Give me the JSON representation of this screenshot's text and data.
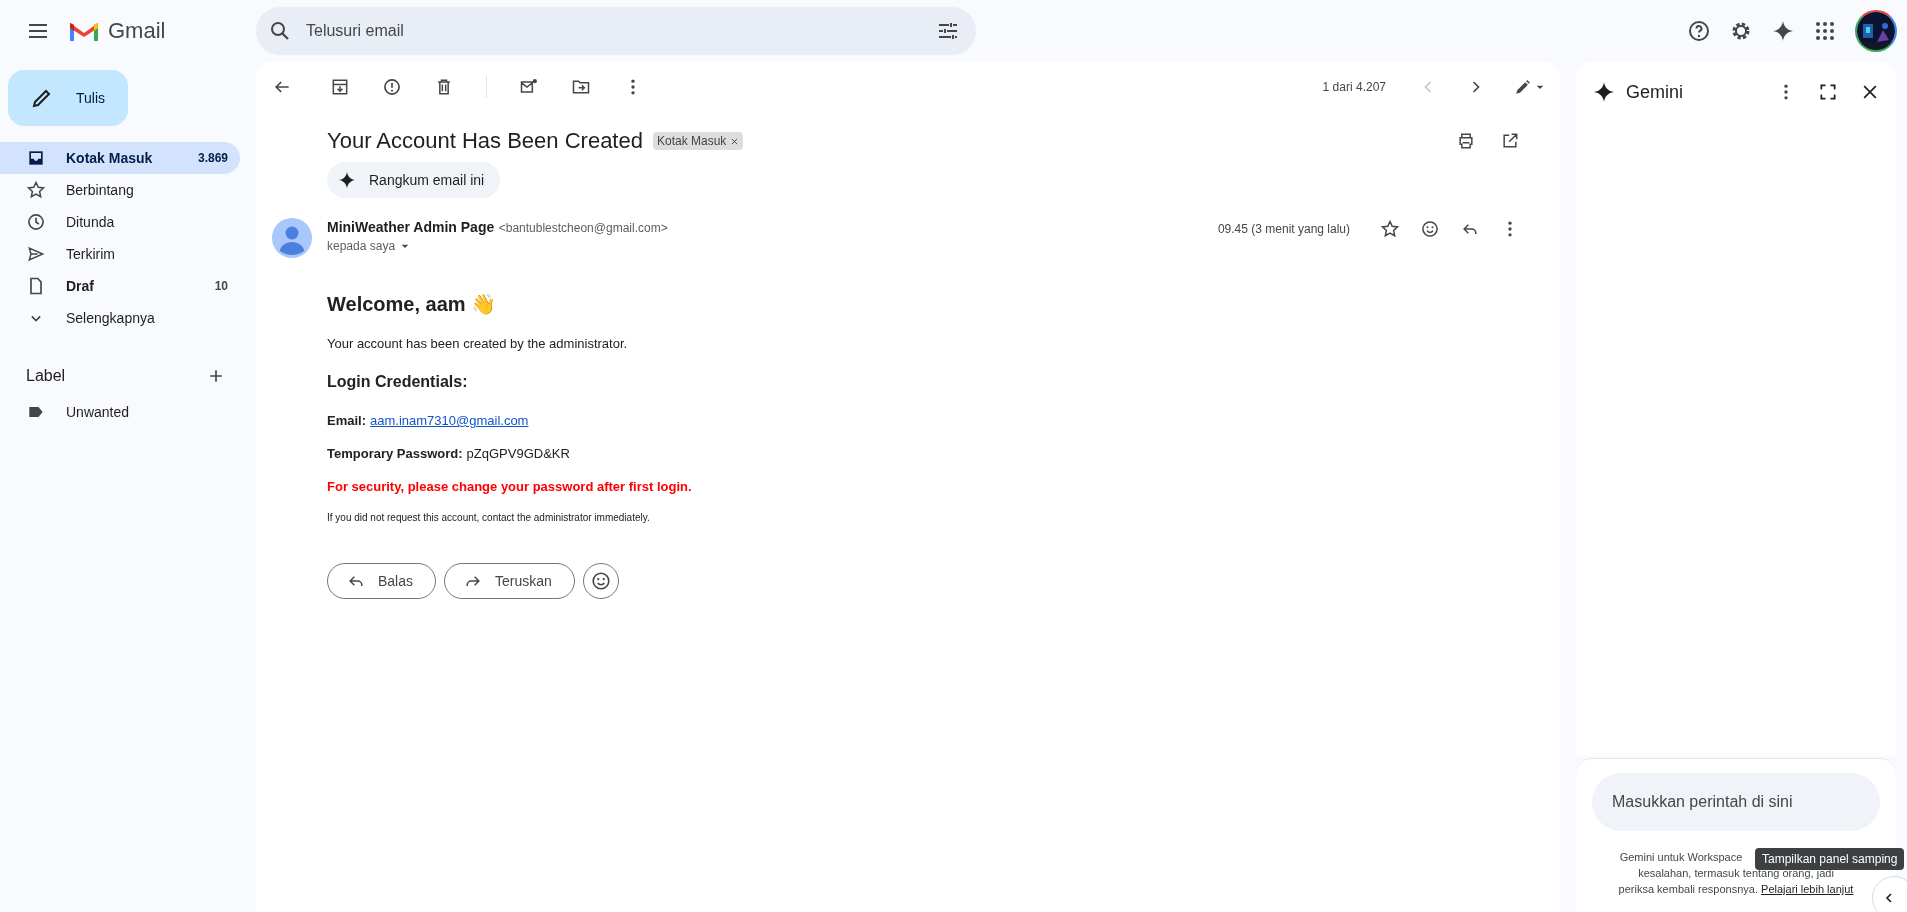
{
  "header": {
    "logo_text": "Gmail",
    "search": {
      "placeholder": "Telusuri email"
    }
  },
  "sidebar": {
    "compose": "Tulis",
    "items": [
      {
        "label": "Kotak Masuk",
        "count": "3.869",
        "selected": true,
        "unread": true
      },
      {
        "label": "Berbintang",
        "selected": false,
        "unread": false
      },
      {
        "label": "Ditunda",
        "selected": false,
        "unread": false
      },
      {
        "label": "Terkirim",
        "selected": false,
        "unread": false
      },
      {
        "label": "Draf",
        "count": "10",
        "selected": false,
        "unread": true
      },
      {
        "label": "Selengkapnya",
        "selected": false,
        "unread": false
      }
    ],
    "labels_heading": "Label",
    "labels": [
      {
        "label": "Unwanted"
      }
    ]
  },
  "email": {
    "counter": "1 dari 4.207",
    "subject": "Your Account Has Been Created",
    "label_chip": "Kotak Masuk",
    "summarize": "Rangkum email ini",
    "sender": {
      "name": "MiniWeather Admin Page",
      "address": "<bantublestcheon@gmail.com>",
      "to": "kepada saya",
      "time": "09.45 (3 menit yang lalu)"
    },
    "body": [
      {
        "kind": "heading",
        "text": "Welcome, aam 👋"
      },
      {
        "kind": "paragraph",
        "text": "Your account has been created by the administrator."
      },
      {
        "kind": "subheading",
        "text": "Login Credentials:"
      },
      {
        "kind": "field",
        "label": "Email:",
        "value": "aam.inam7310@gmail.com",
        "link": true
      },
      {
        "kind": "field",
        "label": "Temporary Password:",
        "value": "pZqGPV9GD&KR",
        "link": false
      },
      {
        "kind": "warning",
        "text": "For security, please change your password after first login."
      },
      {
        "kind": "note",
        "text": "If you did not request this account, contact the administrator immediately."
      }
    ],
    "actions": [
      "Balas",
      "Teruskan"
    ]
  },
  "gemini": {
    "title": "Gemini",
    "prompt_placeholder": "Masukkan perintah di sini",
    "disclaimer_lines": [
      "Gemini untuk Workspace",
      "kesalahan, termasuk tentang orang, jadi",
      "periksa kembali responsnya."
    ],
    "link": "Pelajari lebih lanjut",
    "tooltip": "Tampilkan panel samping"
  }
}
